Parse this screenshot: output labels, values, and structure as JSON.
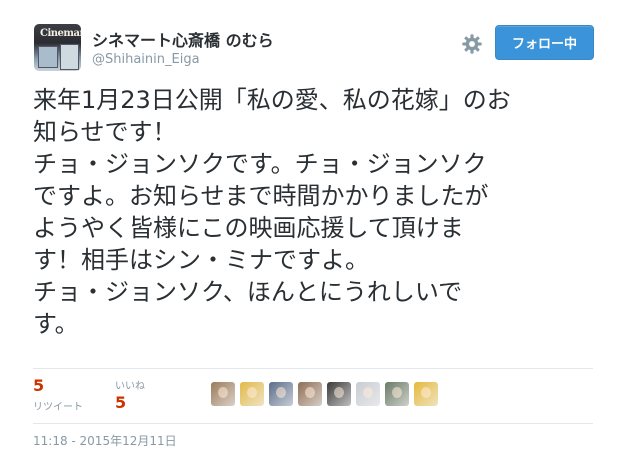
{
  "user": {
    "name": "シネマート心斎橋 のむら",
    "screen_name": "@Shihainin_Eiga",
    "avatar_sign": "Cinemart"
  },
  "follow_button": {
    "label": "フォロー中"
  },
  "tweet": {
    "lines": [
      "来年1月23日公開「私の愛、私の花嫁」のお",
      "知らせです！",
      "チョ・ジョンソクです。チョ・ジョンソク",
      "ですよ。お知らせまで時間かかりましたが",
      "ようやく皆様にこの映画応援して頂けま",
      "す！相手はシン・ミナですよ。",
      "チョ・ジョンソク、ほんとにうれしいで",
      "す。"
    ]
  },
  "stats": {
    "retweets": {
      "count": "5",
      "label": "リツイート"
    },
    "likes": {
      "count": "5",
      "label": "いいね"
    }
  },
  "likers": [
    {
      "name": "liker-1",
      "color": "#9a7b5a"
    },
    {
      "name": "liker-2",
      "color": "#e2b948"
    },
    {
      "name": "liker-3",
      "color": "#5a6d8a"
    },
    {
      "name": "liker-4",
      "color": "#8f6e55"
    },
    {
      "name": "liker-5",
      "color": "#3b3a3a"
    },
    {
      "name": "liker-6",
      "color": "#c8ccd2"
    },
    {
      "name": "liker-7",
      "color": "#6b7a66"
    },
    {
      "name": "liker-8",
      "color": "#e5b93c"
    }
  ],
  "timestamp": "11:18 - 2015年12月11日",
  "colors": {
    "accent": "#3b94d9",
    "count": "#cc3300",
    "muted": "#8899a6"
  },
  "icons": {
    "settings": "gear-icon"
  }
}
